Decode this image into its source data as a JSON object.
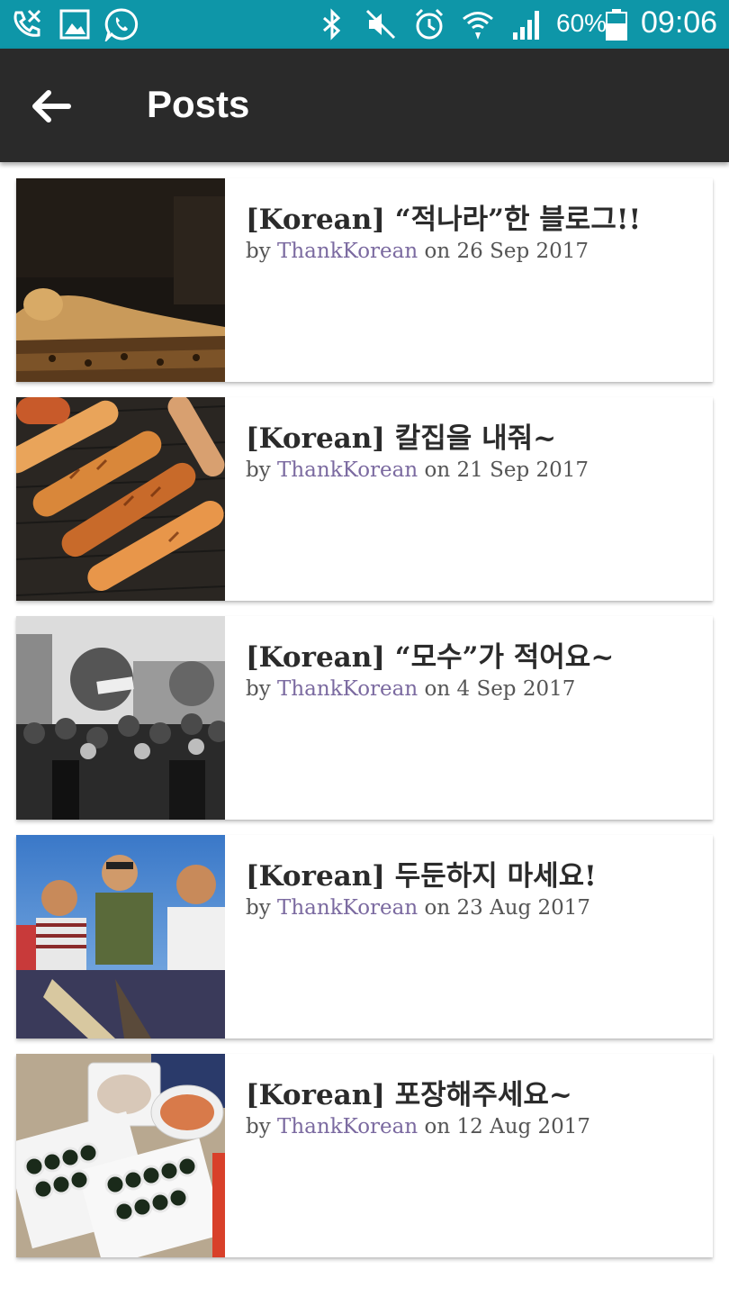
{
  "status_bar": {
    "battery_percent": "60%",
    "time": "09:06",
    "icons": [
      "missed-call-icon",
      "gallery-icon",
      "whatsapp-icon",
      "bluetooth-icon",
      "mute-icon",
      "alarm-icon",
      "wifi-icon",
      "signal-icon",
      "battery-icon"
    ],
    "color": "#0e96a8"
  },
  "app_bar": {
    "title": "Posts",
    "back_icon": "arrow-left-icon",
    "color": "#2a2a2a"
  },
  "posts": [
    {
      "title": "[Korean] “적나라”한 블로그!!",
      "by": "by",
      "author": "ThankKorean",
      "on": "on",
      "date": "26 Sep 2017",
      "thumbnail": "reclining-figure-painting"
    },
    {
      "title": "[Korean] 칼집을 내줘~",
      "by": "by",
      "author": "ThankKorean",
      "on": "on",
      "date": "21 Sep 2017",
      "thumbnail": "grilled-sausages"
    },
    {
      "title": "[Korean] “모수”가 적어요~",
      "by": "by",
      "author": "ThankKorean",
      "on": "on",
      "date": "4 Sep 2017",
      "thumbnail": "street-crowd-bw"
    },
    {
      "title": "[Korean] 두둔하지 마세요!",
      "by": "by",
      "author": "ThankKorean",
      "on": "on",
      "date": "23 Aug 2017",
      "thumbnail": "boys-group-photo"
    },
    {
      "title": "[Korean] 포장해주세요~",
      "by": "by",
      "author": "ThankKorean",
      "on": "on",
      "date": "12 Aug 2017",
      "thumbnail": "kimbap-takeout"
    }
  ],
  "colors": {
    "author_link": "#7b6aa0",
    "title_text": "#2b2b2b"
  }
}
